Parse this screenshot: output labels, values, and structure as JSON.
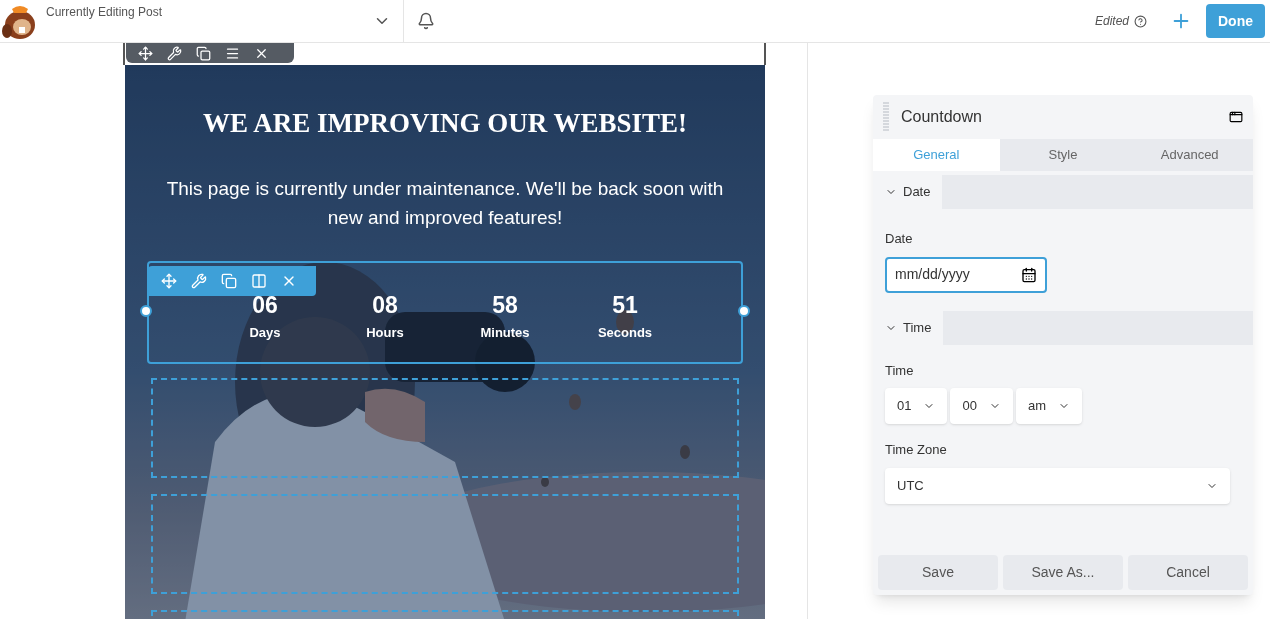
{
  "topbar": {
    "title": "Currently Editing Post",
    "status": "Edited",
    "done": "Done"
  },
  "hero": {
    "heading": "WE ARE IMPROVING OUR WEBSITE!",
    "text": "This page is currently under maintenance. We'll be back soon with new and improved features!"
  },
  "countdown": [
    {
      "value": "06",
      "label": "Days"
    },
    {
      "value": "08",
      "label": "Hours"
    },
    {
      "value": "58",
      "label": "Minutes"
    },
    {
      "value": "51",
      "label": "Seconds"
    }
  ],
  "panel": {
    "title": "Countdown",
    "tabs": [
      {
        "label": "General",
        "selected": true
      },
      {
        "label": "Style",
        "selected": false
      },
      {
        "label": "Advanced",
        "selected": false
      }
    ],
    "sections": [
      {
        "title": "Date",
        "expanded": true,
        "fields": [
          {
            "kind": "date",
            "label": "Date",
            "placeholder": "mm/dd/yyyy",
            "focused": true
          }
        ]
      },
      {
        "title": "Time",
        "expanded": true,
        "fields": [
          {
            "kind": "time",
            "label": "Time",
            "selects": [
              "01",
              "00",
              "am"
            ]
          },
          {
            "kind": "select",
            "label": "Time Zone",
            "value": "UTC"
          }
        ]
      }
    ],
    "buttons": [
      "Save",
      "Save As...",
      "Cancel"
    ]
  }
}
